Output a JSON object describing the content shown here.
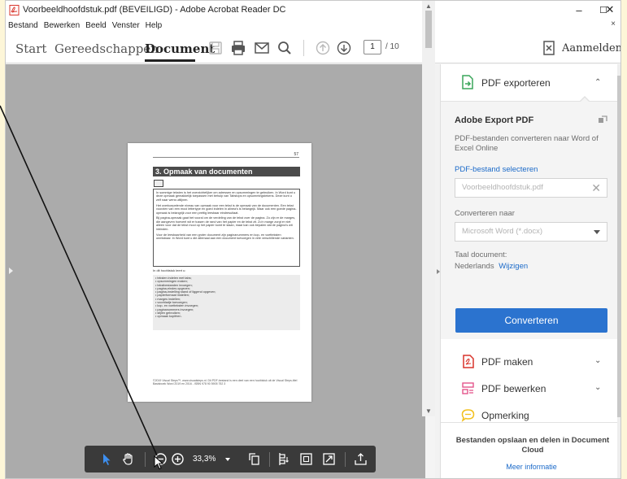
{
  "window": {
    "title": "Voorbeeldhoofdstuk.pdf (BEVEILIGD) - Adobe Acrobat Reader DC",
    "minimize": "–",
    "maximize": "☐",
    "close": "✕"
  },
  "menubar": {
    "items": [
      "Bestand",
      "Bewerken",
      "Beeld",
      "Venster",
      "Help"
    ],
    "close": "×"
  },
  "toolbar": {
    "tabs": [
      "Start",
      "Gereedschappen",
      "Document"
    ],
    "active_tab": "Document",
    "page_current": "1",
    "page_total": "/ 10",
    "signin_label": "Aanmelden"
  },
  "page": {
    "number": "57",
    "heading": "3. Opmaak van documenten",
    "paragraphs": [
      "In sommige teksten is het overzichtelijker om adressen en opsommingen te gebruiken. In Word kunt u deze opmaak gemakkelijk toepassen met behulp van Tabstops en opsommingstekens. Deze kunt u zelf naar wens uitlijnen.",
      "Het overkoepelende niveau van opmaak voor een tekst is de opmaak van de documenten. Een tekst voorzien van een mooi lettertype en goed indelen in alinea's is belangrijk. Maar ook een goede pagina-opmaak is belangrijk voor een prettig leesbaar eindresultaat.",
      "Bij pagina-opmaak gaat het vooral om de verdeling van de tekst over de pagina. Zo zijn er de marges, die aangeven hoeveel wit er tussen de rand van het papier en de tekst zit. Zo'n marge zorgt er niet alleen voor dat de tekst mooi op het papier komt te staan, maar kan ook bepalen dat de pagina's wit inbinden.",
      "Voor de leesbaarheid van een groter document zijn paginanummers en kop- en voetteksten onmisbaar. In Word kunt u die allemaal aan een document toevoegen in vele verschillende varianten."
    ],
    "intro": "In dit hoofdstuk leert u:",
    "list": [
      "teksten indelen met tabs;",
      "opsommingen maken;",
      "tekstbestanden invoegen;",
      "pagina-eindes opgeven;",
      "pagina-instelling stand of liggend opgeven;",
      "papierformaat instellen;",
      "marges instellen;",
      "voorbladje toevoegen;",
      "kop- en voetteksten invoegen;",
      "paginanummers invoegen;",
      "stijlen gebruiken;",
      "opmaak kopiëren."
    ],
    "footer": "©2019 Visual Steps™, www.visualsteps.nl. Dit PDF-bestand is een deel van een hoofdstuk uit de Visual Steps-titel Basisboek Word 2019 en 2016 - ISBN 978 90 5905 752 3"
  },
  "floatbar": {
    "zoom": "33,3%"
  },
  "right_pane": {
    "export_title": "PDF exporteren",
    "adobe_export_title": "Adobe Export PDF",
    "adobe_export_desc": "PDF-bestanden converteren naar Word of Excel Online",
    "select_link": "PDF-bestand selecteren",
    "file_field": "Voorbeeldhoofdstuk.pdf",
    "convert_to_label": "Converteren naar",
    "format_field": "Microsoft Word (*.docx)",
    "language_label": "Taal document:",
    "language_value": "Nederlands",
    "change_link": "Wijzigen",
    "convert_button": "Converteren",
    "tools": [
      "PDF maken",
      "PDF bewerken",
      "Opmerking"
    ],
    "footer_text": "Bestanden opslaan en delen in Document Cloud",
    "footer_link": "Meer informatie"
  },
  "colors": {
    "accent_blue": "#2b73cf",
    "link_blue": "#1b6ac9",
    "pdf_red": "#d9342b",
    "comment_yellow": "#f2c01d"
  }
}
